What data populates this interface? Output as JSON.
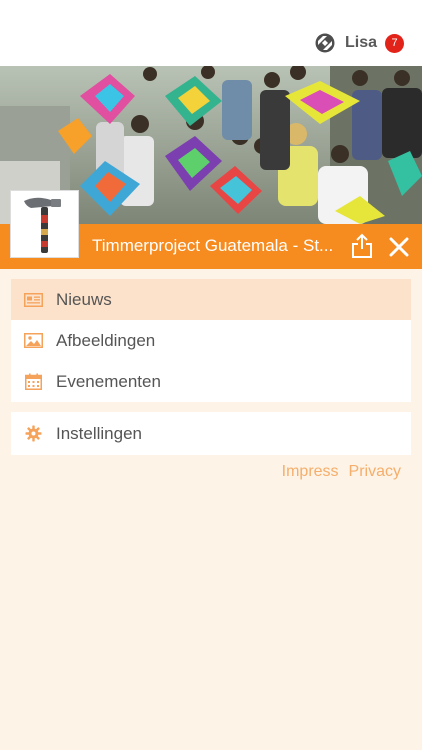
{
  "user": {
    "name": "Lisa",
    "notification_count": "7"
  },
  "project": {
    "title": "Timmerproject Guatemala - St..."
  },
  "menu_main": [
    {
      "label": "Nieuws",
      "icon": "newspaper-icon",
      "active": true
    },
    {
      "label": "Afbeeldingen",
      "icon": "image-icon",
      "active": false
    },
    {
      "label": "Evenementen",
      "icon": "calendar-icon",
      "active": false
    }
  ],
  "menu_secondary": [
    {
      "label": "Instellingen",
      "icon": "gear-icon",
      "active": false
    }
  ],
  "footer": {
    "impress": "Impress",
    "privacy": "Privacy"
  },
  "colors": {
    "accent": "#f68b1f",
    "background": "#fdf3e7",
    "active_item": "#fde2cb",
    "badge": "#e2231a",
    "footer_link": "#f5ae6b"
  }
}
